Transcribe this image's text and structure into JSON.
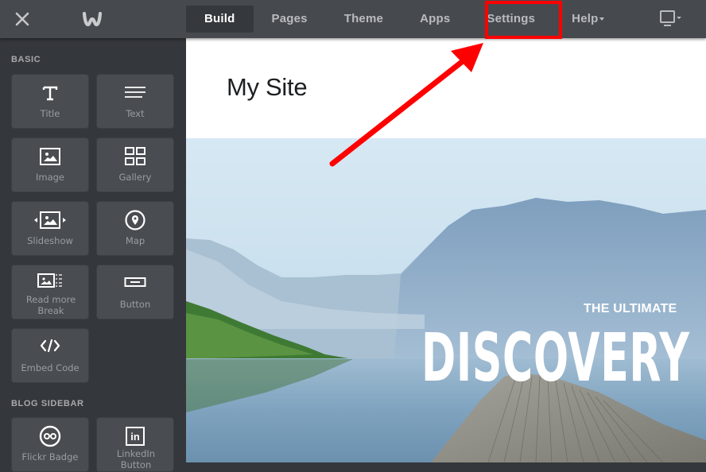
{
  "topbar": {
    "close_icon": "close-icon",
    "logo_icon": "weebly-logo-icon",
    "nav": [
      {
        "label": "Build",
        "active": true
      },
      {
        "label": "Pages",
        "active": false
      },
      {
        "label": "Theme",
        "active": false
      },
      {
        "label": "Apps",
        "active": false
      },
      {
        "label": "Settings",
        "active": false,
        "highlighted": true
      },
      {
        "label": "Help",
        "active": false,
        "dropdown": true
      }
    ],
    "device_icon": "desktop-monitor-icon"
  },
  "sidebar": {
    "sections": [
      {
        "label": "BASIC",
        "items": [
          {
            "label": "Title",
            "icon": "title-icon"
          },
          {
            "label": "Text",
            "icon": "text-icon"
          },
          {
            "label": "Image",
            "icon": "image-icon"
          },
          {
            "label": "Gallery",
            "icon": "gallery-icon"
          },
          {
            "label": "Slideshow",
            "icon": "slideshow-icon"
          },
          {
            "label": "Map",
            "icon": "map-pin-icon"
          },
          {
            "label": "Read more Break",
            "icon": "read-more-icon"
          },
          {
            "label": "Button",
            "icon": "button-icon"
          },
          {
            "label": "Embed Code",
            "icon": "code-icon"
          }
        ]
      },
      {
        "label": "BLOG SIDEBAR",
        "items": [
          {
            "label": "Flickr Badge",
            "icon": "flickr-icon"
          },
          {
            "label": "LinkedIn Button",
            "icon": "linkedin-icon"
          }
        ]
      }
    ]
  },
  "canvas": {
    "site_title": "My Site",
    "hero": {
      "kicker": "THE ULTIMATE",
      "headline": "DISCOVERY G"
    }
  },
  "annotation": {
    "highlight_color": "#ff0000",
    "target": "Settings"
  },
  "colors": {
    "topbar_bg": "#464a4f",
    "sidebar_bg": "#34373b",
    "tile_bg": "#494c50",
    "active_tab_bg": "#35383c",
    "annotation_red": "#ff0000"
  }
}
